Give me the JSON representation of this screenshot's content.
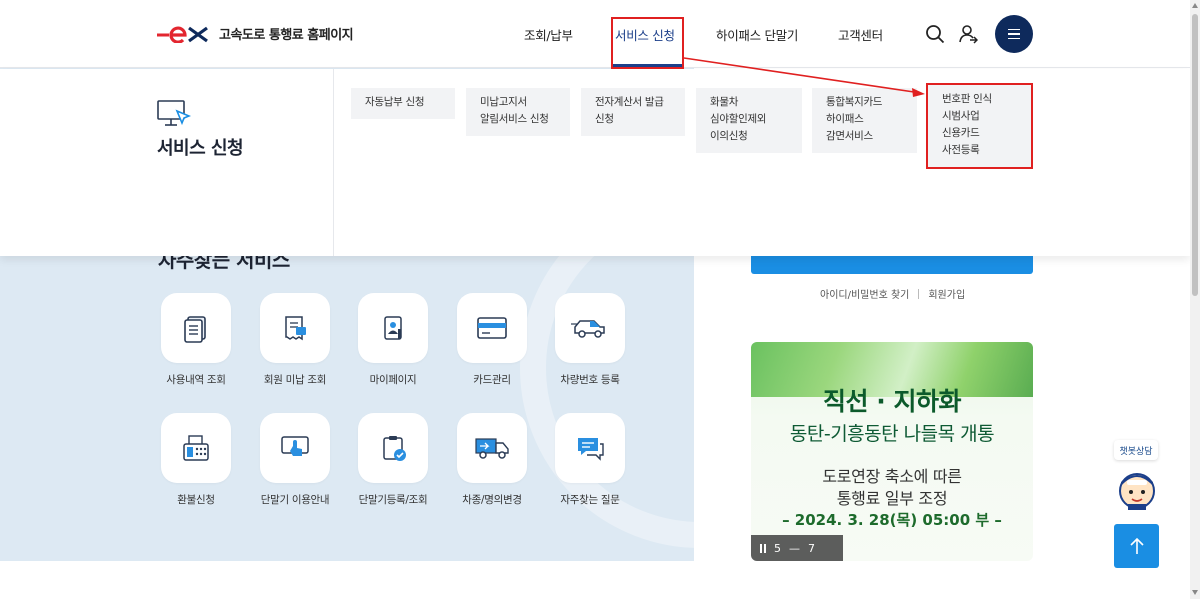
{
  "header": {
    "logo_text": "고속도로 통행료 홈페이지",
    "nav": [
      {
        "label": "조회/납부"
      },
      {
        "label": "서비스 신청"
      },
      {
        "label": "하이패스 단말기"
      },
      {
        "label": "고객센터"
      }
    ],
    "icons": [
      "search-icon",
      "user-icon",
      "hamburger-menu-icon"
    ]
  },
  "mega_menu": {
    "title": "서비스 신청",
    "icon": "monitor-cursor-icon",
    "items": [
      {
        "lines": [
          "자동납부 신청"
        ]
      },
      {
        "lines": [
          "미납고지서",
          "알림서비스 신청"
        ]
      },
      {
        "lines": [
          "전자계산서 발급",
          "신청"
        ]
      },
      {
        "lines": [
          "화물차",
          "심야할인제외",
          "이의신청"
        ]
      },
      {
        "lines": [
          "통합복지카드",
          "하이패스",
          "감면서비스"
        ]
      },
      {
        "lines": [
          "번호판 인식",
          "시범사업",
          "신용카드",
          "사전등록"
        ]
      }
    ]
  },
  "faq": {
    "title": "자주찾는 서비스",
    "items": [
      {
        "label": "사용내역 조회",
        "icon": "document-list-icon"
      },
      {
        "label": "회원 미납 조회",
        "icon": "receipt-icon"
      },
      {
        "label": "마이페이지",
        "icon": "id-card-icon"
      },
      {
        "label": "카드관리",
        "icon": "credit-card-icon"
      },
      {
        "label": "차량번호 등록",
        "icon": "car-icon"
      },
      {
        "label": "환불신청",
        "icon": "fax-calculator-icon"
      },
      {
        "label": "단말기 이용안내",
        "icon": "touch-screen-icon"
      },
      {
        "label": "단말기등록/조회",
        "icon": "clipboard-check-icon"
      },
      {
        "label": "차종/명의변경",
        "icon": "truck-icon"
      },
      {
        "label": "자주찾는 질문",
        "icon": "chat-bubble-icon"
      }
    ]
  },
  "login": {
    "find_link": "아이디/비밀번호 찾기",
    "join_link": "회원가입"
  },
  "banner": {
    "line1": "직선 · 지하화",
    "line2": "동탄-기흥동탄 나들목 개통",
    "line3": "도로연장 축소에 따른",
    "line4": "통행료 일부 조정",
    "line5": "– 2024. 3. 28(목) 05:00 부 –",
    "pager_current": "5",
    "pager_sep": "—",
    "pager_total": "7"
  },
  "chatbot": {
    "label": "챗봇상담"
  },
  "colors": {
    "brand_navy": "#0e2a5c",
    "accent_blue": "#1a8ee3",
    "logo_red": "#e3262f",
    "annotation_red": "#e02020"
  }
}
